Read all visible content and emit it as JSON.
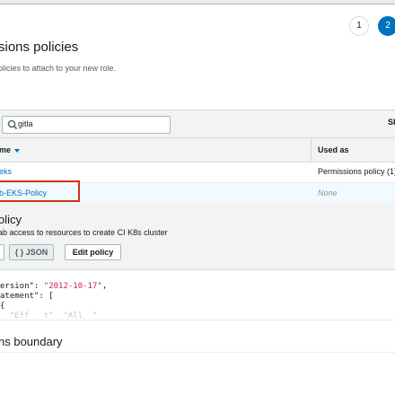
{
  "wizard": {
    "steps": [
      "1",
      "2"
    ]
  },
  "page": {
    "title": "sions policies",
    "subtitle": "olicies to attach to your new role."
  },
  "search": {
    "value": "gitla",
    "show_label": "Sh"
  },
  "table": {
    "columns": [
      "me",
      "Used as"
    ],
    "rows": [
      {
        "name": "eks",
        "used_as": "Permissions policy (1)"
      },
      {
        "name": "b-EKS-Policy",
        "used_as": "None"
      }
    ]
  },
  "policy_detail": {
    "title": "olicy",
    "description": "ab access to resources to create CI K8s cluster",
    "json_button": "{ } JSON",
    "edit_button": "Edit policy"
  },
  "code": {
    "line1_key": "ersion\": ",
    "line1_val": "\"2012-10-17\"",
    "line1_end": ",",
    "line2": "atement\": [",
    "line3": "{",
    "line4": "  \"Eff   t\"  \"All  \""
  },
  "boundary": {
    "title": "ns boundary"
  },
  "colors": {
    "accent": "#0073bb",
    "highlight": "#d13212"
  }
}
